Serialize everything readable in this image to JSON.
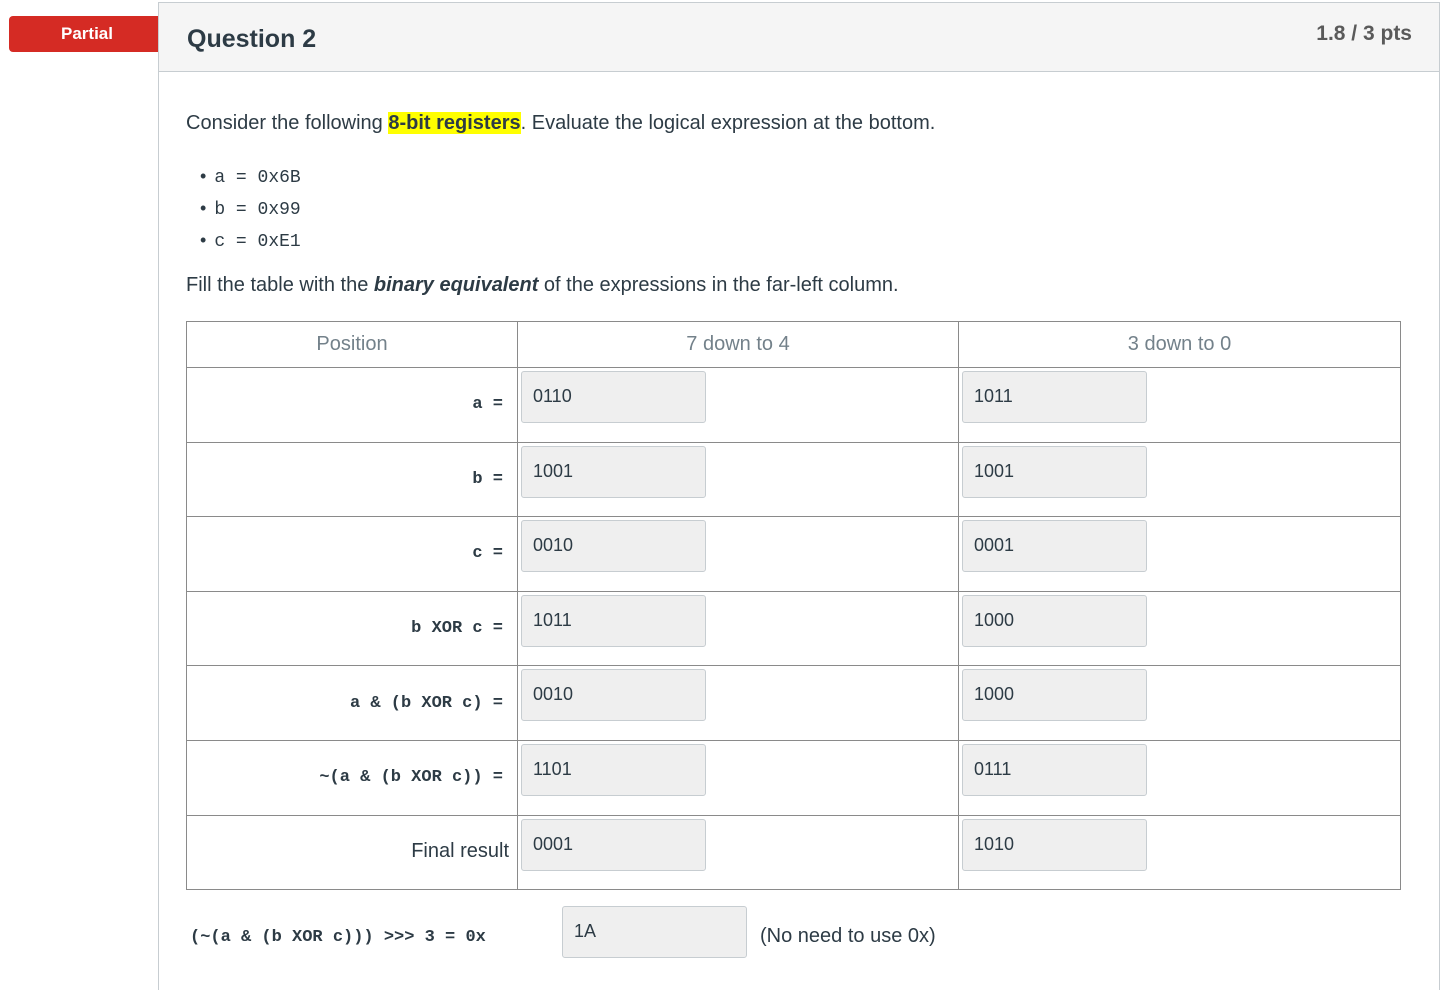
{
  "badge": "Partial",
  "question": {
    "title": "Question 2",
    "points": "1.8 / 3 pts"
  },
  "intro": {
    "before": "Consider the following ",
    "highlight": "8-bit registers",
    "after": ".  Evaluate the logical expression at the bottom."
  },
  "registers": [
    "a = 0x6B",
    "b = 0x99",
    "c = 0xE1"
  ],
  "instruction": {
    "before": "Fill the table with the ",
    "bold": "binary equivalent",
    "after": " of the expressions in the far-left column."
  },
  "table": {
    "headers": [
      "Position",
      "7 down to 4",
      "3 down to 0"
    ],
    "rows": [
      {
        "label": "a =",
        "high": "0110",
        "low": "1011"
      },
      {
        "label": "b =",
        "high": "1001",
        "low": "1001"
      },
      {
        "label": "c =",
        "high": "0010",
        "low": "0001"
      },
      {
        "label": "b XOR c =",
        "high": "1011",
        "low": "1000"
      },
      {
        "label": "a & (b XOR c) =",
        "high": "0010",
        "low": "1000"
      },
      {
        "label": "~(a & (b XOR c)) =",
        "high": "1101",
        "low": "0111"
      },
      {
        "label": "Final result",
        "high": "0001",
        "low": "1010"
      }
    ]
  },
  "final": {
    "expression": "(~(a & (b XOR c))) >>> 3 = 0x",
    "answer": "1A",
    "note": "(No need to use 0x)"
  },
  "colors": {
    "badge": "#d52b24",
    "highlight": "#ffff00",
    "input_bg": "#efefef"
  }
}
